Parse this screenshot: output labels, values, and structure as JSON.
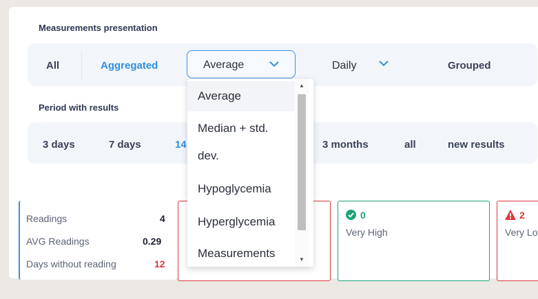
{
  "presentation": {
    "title": "Measurements presentation",
    "options": [
      "All",
      "Aggregated",
      "Grouped"
    ],
    "active": "Aggregated",
    "method_select": "Average",
    "frequency_select": "Daily"
  },
  "dropdown": {
    "items": [
      "Average",
      "Median + std.",
      "dev.",
      "Hypoglycemia",
      "Hyperglycemia",
      "Measurements"
    ],
    "selected": "Average"
  },
  "period": {
    "title": "Period with results",
    "options": [
      "3 days",
      "7 days",
      "14",
      "3 months",
      "all",
      "new results"
    ],
    "active": "14"
  },
  "stats": {
    "readings_label": "Readings",
    "readings_value": "4",
    "avg_label": "AVG Readings",
    "avg_value": "0.29",
    "days_label": "Days without reading",
    "days_value": "12"
  },
  "cards": [
    {
      "count": "0",
      "label": "Very High",
      "status": "ok"
    },
    {
      "count": "2",
      "label": "Very Lo",
      "status": "warning"
    }
  ],
  "colors": {
    "accent": "#2f8fe0",
    "ok": "#1aa37a",
    "alert": "#e0343d"
  }
}
